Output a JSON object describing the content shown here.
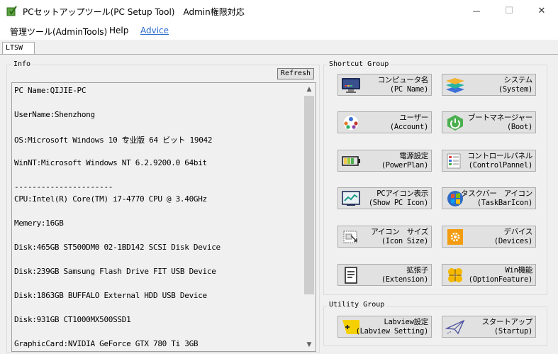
{
  "window": {
    "title": "PCセットアップツール(PC Setup Tool)　Admin権限対応",
    "min_glyph": "—",
    "max_glyph": "☐",
    "close_glyph": "✕"
  },
  "menu": {
    "items": [
      "管理ツール(AdminTools)",
      "Help",
      "Advice"
    ]
  },
  "tabs": [
    "LTSW"
  ],
  "info": {
    "legend": "Info",
    "refresh_label": "Refresh",
    "lines": [
      "PC Name:QIJIE-PC",
      "UserName:Shenzhong",
      "OS:Microsoft Windows 10 专业版 64 ビット 19042",
      "WinNT:Microsoft Windows NT 6.2.9200.0 64bit",
      "----------------------",
      "CPU:Intel(R) Core(TM) i7-4770 CPU @ 3.40GHz",
      "Memery:16GB",
      "Disk:465GB ST500DM0 02-1BD142 SCSI Disk Device",
      "Disk:239GB Samsung Flash Drive FIT USB Device",
      "Disk:1863GB BUFFALO External HDD USB Device",
      "Disk:931GB CT1000MX500SSD1",
      "GraphicCard:NVIDIA GeForce GTX 780 Ti 3GB"
    ],
    "scroll_up": "▲",
    "scroll_down": "▼"
  },
  "shortcut_group": {
    "legend": "Shortcut Group",
    "buttons": [
      {
        "line1": "コンピュータ名",
        "line2": "(PC Name)",
        "icon": "monitor-icon"
      },
      {
        "line1": "システム",
        "line2": "(System)",
        "icon": "layers-icon"
      },
      {
        "line1": "ユーザー",
        "line2": "(Account)",
        "icon": "users-icon"
      },
      {
        "line1": "ブートマネージャー",
        "line2": "(Boot)",
        "icon": "power-icon"
      },
      {
        "line1": "電源設定",
        "line2": "(PowerPlan)",
        "icon": "battery-icon"
      },
      {
        "line1": "コントロールパネル",
        "line2": "(ControlPannel)",
        "icon": "control-panel-icon"
      },
      {
        "line1": "PCアイコン表示",
        "line2": "(Show PC Icon)",
        "icon": "chart-screen-icon"
      },
      {
        "line1": "タスクバー　アイコン",
        "line2": "(TaskBarIcon)",
        "icon": "windows-globe-icon"
      },
      {
        "line1": "アイコン　サイズ",
        "line2": "(Icon Size)",
        "icon": "resize-icon"
      },
      {
        "line1": "デバイス",
        "line2": "(Devices)",
        "icon": "gear-icon"
      },
      {
        "line1": "拡張子",
        "line2": "(Extension)",
        "icon": "document-icon"
      },
      {
        "line1": "Win機能",
        "line2": "(OptionFeature)",
        "icon": "clover-icon"
      }
    ]
  },
  "utility_group": {
    "legend": "Utility Group",
    "buttons": [
      {
        "line1": "Labview設定",
        "line2": "(Labview Setting)",
        "icon": "labview-icon"
      },
      {
        "line1": "スタートアップ",
        "line2": "(Startup)",
        "icon": "paper-plane-icon"
      }
    ]
  },
  "colors": {
    "link": "#2a6acb",
    "button_face": "#e1e1e1",
    "window_bg": "#f0f0f0"
  }
}
